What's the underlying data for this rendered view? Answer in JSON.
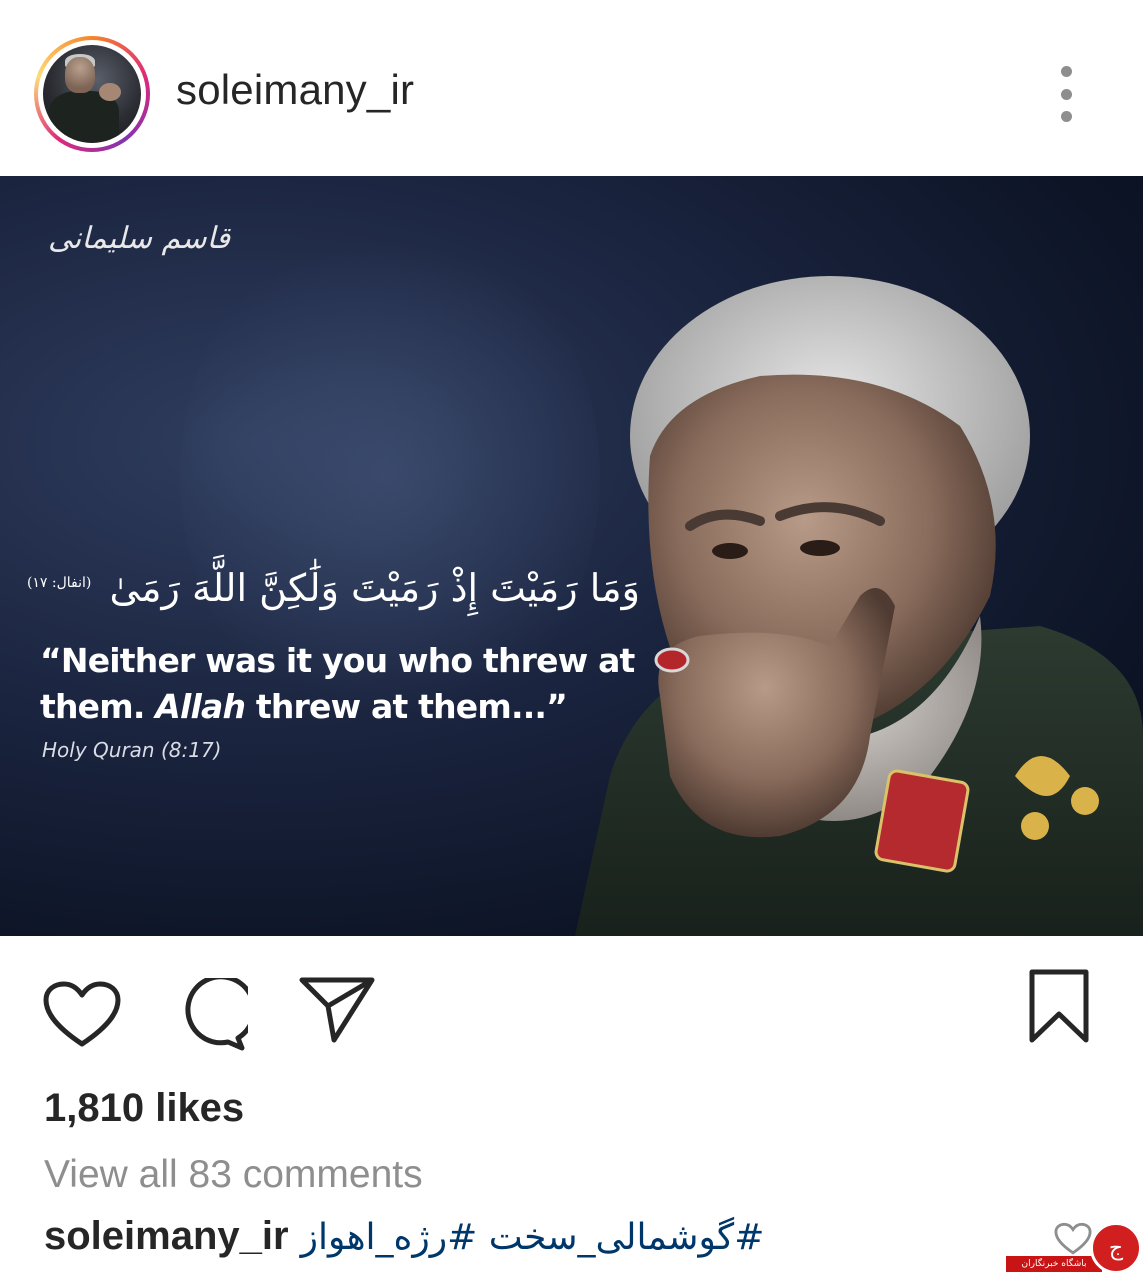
{
  "header": {
    "username": "soleimany_ir",
    "avatar_icon": "profile-photo",
    "more_icon": "three-dots-vertical-icon"
  },
  "post": {
    "image": {
      "calligraphy_signature": "قاسم سلیمانی",
      "arabic_verse": "وَمَا رَمَيْتَ إِذْ رَمَيْتَ وَلَٰكِنَّ اللَّهَ رَمَىٰ",
      "arabic_reference": "(انفال: ۱۷)",
      "quote_line1": "“Neither was it you who threw at",
      "quote_line2_a": "them. ",
      "quote_line2_b": "Allah",
      "quote_line2_c": " threw at them...”",
      "quote_reference": "Holy Quran (8:17)"
    },
    "actions": {
      "like_icon": "heart-icon",
      "comment_icon": "comment-icon",
      "share_icon": "paper-plane-icon",
      "save_icon": "bookmark-icon"
    },
    "likes_text": "1,810 likes",
    "view_comments_text": "View all 83 comments",
    "caption": {
      "username": "soleimany_ir",
      "text": "#گوشمالی_سخت #رژه_اهواز"
    }
  },
  "watermark": {
    "text": "باشگاه خبرنگاران",
    "logo_glyph": "ج"
  }
}
